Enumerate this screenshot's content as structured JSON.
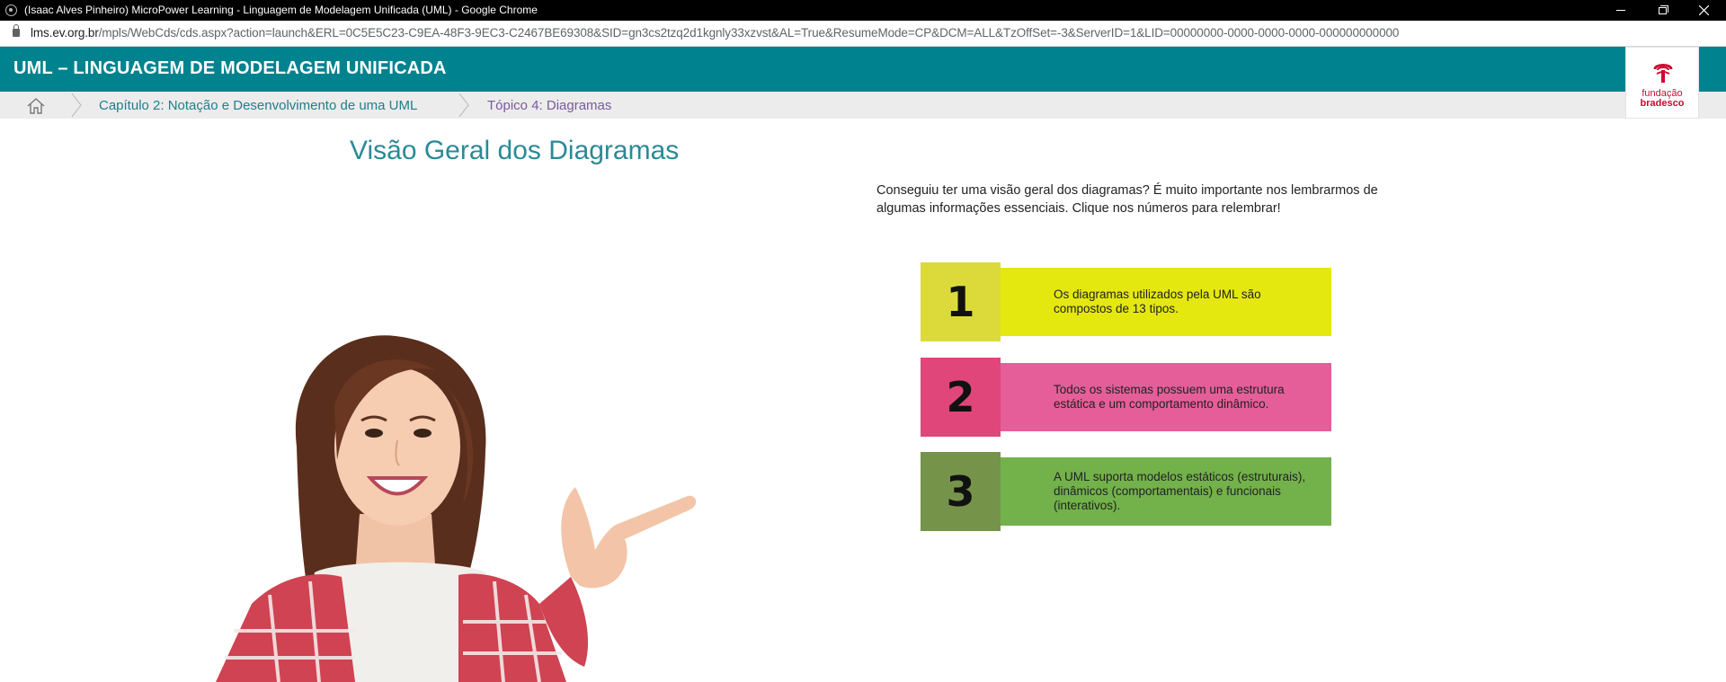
{
  "window": {
    "title": "(Isaac Alves Pinheiro) MicroPower Learning - Linguagem de Modelagem Unificada (UML) - Google Chrome"
  },
  "address_bar": {
    "host": "lms.ev.org.br",
    "path": "/mpls/WebCds/cds.aspx?action=launch&ERL=0C5E5C23-C9EA-48F3-9EC3-C2467BE69308&SID=gn3cs2tzq2d1kgnly33xzvst&AL=True&ResumeMode=CP&DCM=ALL&TzOffSet=-3&ServerID=1&LID=00000000-0000-0000-0000-000000000000"
  },
  "header": {
    "course_title": "UML – LINGUAGEM DE MODELAGEM UNIFICADA",
    "logo_line1": "fundação",
    "logo_line2": "bradesco"
  },
  "breadcrumb": {
    "items": [
      {
        "label": "Capítulo 2: Notação e Desenvolvimento de uma UML"
      },
      {
        "label": "Tópico 4: Diagramas"
      }
    ]
  },
  "main": {
    "title": "Visão Geral dos Diagramas",
    "intro": "Conseguiu ter uma visão geral dos diagramas? É muito importante nos lembrarmos de algumas informações essenciais. Clique nos números para relembrar!",
    "cards": [
      {
        "number": "1",
        "text": "Os diagramas utilizados pela UML são compostos de 13 tipos.",
        "num_color": "#dcda3a",
        "text_color": "#e5e80e"
      },
      {
        "number": "2",
        "text": "Todos os sistemas possuem uma estrutura estática e um comportamento dinâmico.",
        "num_color": "#e0467a",
        "text_color": "#e55e99"
      },
      {
        "number": "3",
        "text": "A UML suporta modelos estáticos (estruturais), dinâmicos (comportamentais) e funcionais (interativos).",
        "num_color": "#76934a",
        "text_color": "#73b14b"
      }
    ]
  },
  "colors": {
    "header_bg": "#00838f",
    "breadcrumb_bg": "#ececec",
    "title_color": "#2a8a96",
    "logo_red": "#cc0a2f"
  }
}
